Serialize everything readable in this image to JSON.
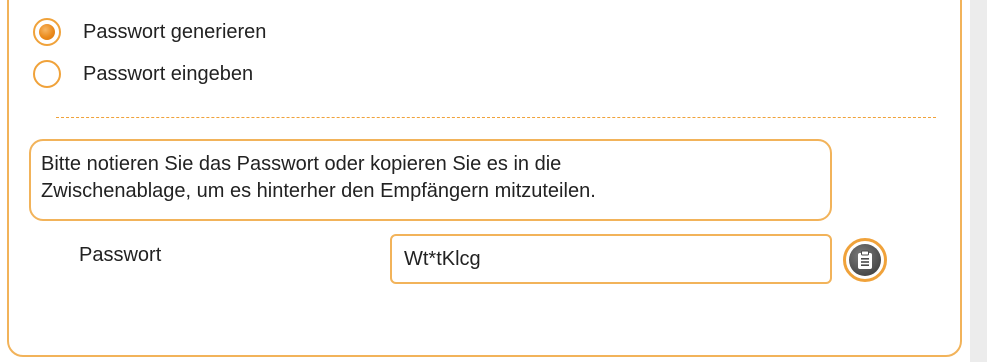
{
  "options": {
    "generate_label": "Passwort generieren",
    "generate_selected": true,
    "enter_label": "Passwort eingeben",
    "enter_selected": false
  },
  "info": {
    "line1": "Bitte notieren Sie das Passwort oder kopieren Sie es in die",
    "line2": "Zwischenablage, um es hinterher den Empfängern mitzuteilen."
  },
  "password": {
    "label": "Passwort",
    "value": "Wt*tKlcg"
  },
  "icons": {
    "copy": "clipboard-icon"
  },
  "colors": {
    "accent": "#f0a23a",
    "accent_dark": "#d9740a",
    "icon_dark": "#4a4a4a",
    "scroll_gutter": "#ececec"
  }
}
